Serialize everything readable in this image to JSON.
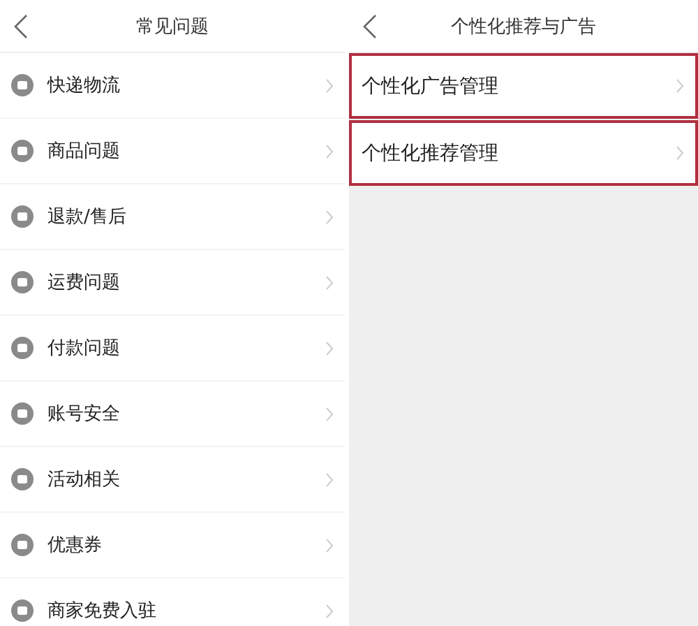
{
  "left_screen": {
    "title": "常见问题",
    "items": [
      {
        "label": "快递物流"
      },
      {
        "label": "商品问题"
      },
      {
        "label": "退款/售后"
      },
      {
        "label": "运费问题"
      },
      {
        "label": "付款问题"
      },
      {
        "label": "账号安全"
      },
      {
        "label": "活动相关"
      },
      {
        "label": "优惠券"
      },
      {
        "label": "商家免费入驻"
      }
    ]
  },
  "right_screen": {
    "title": "个性化推荐与广告",
    "items": [
      {
        "label": "个性化广告管理",
        "highlighted": true
      },
      {
        "label": "个性化推荐管理",
        "highlighted": true
      }
    ]
  }
}
